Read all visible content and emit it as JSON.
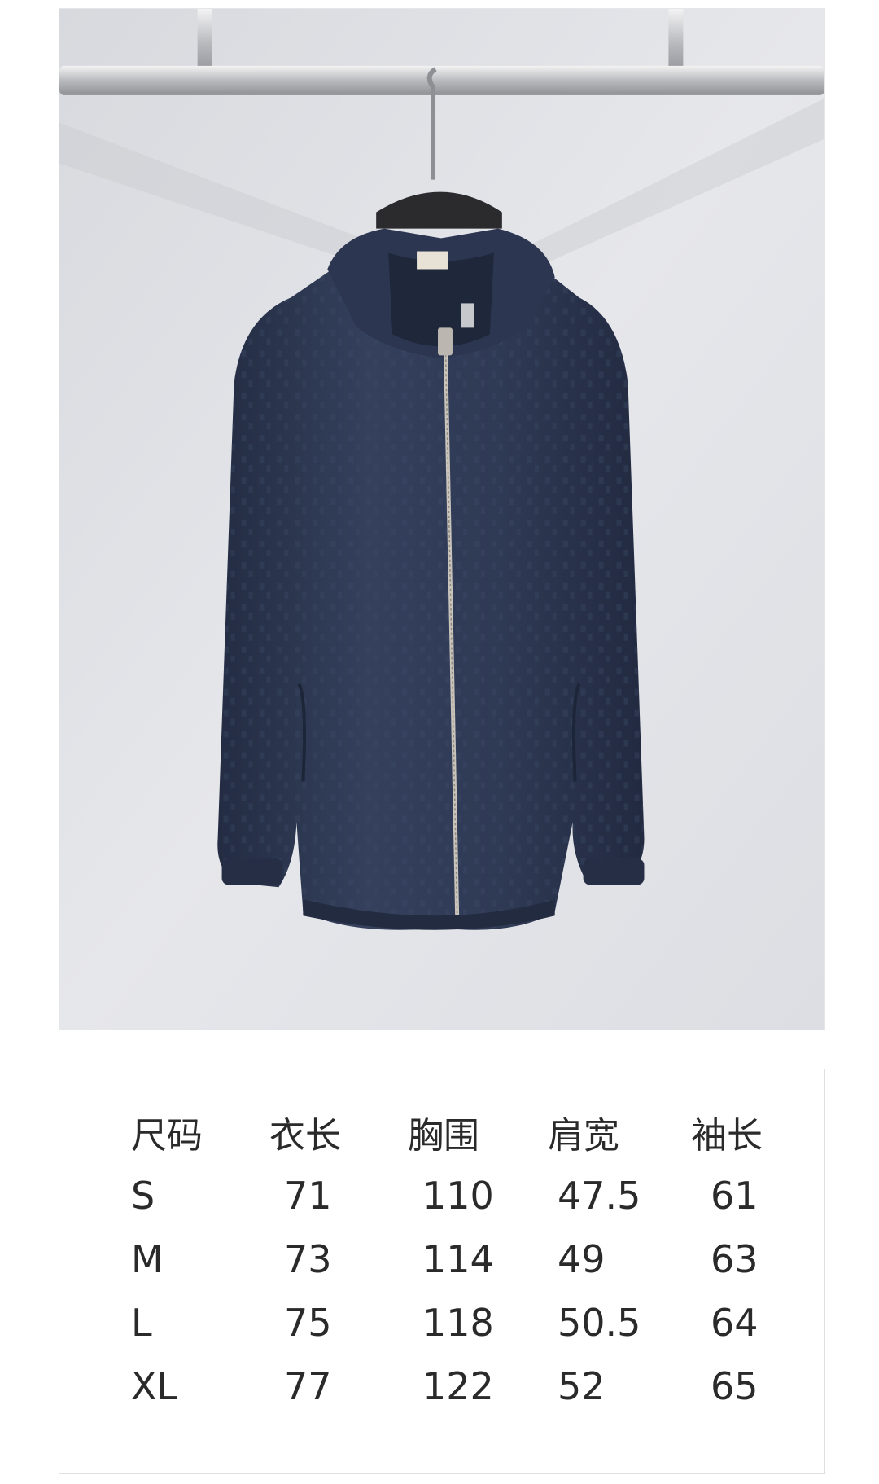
{
  "product_photo": {
    "description_icon": "jacket-photo",
    "colors": {
      "background": "#dfe1e6",
      "jacket": "#2d3852",
      "rail": "#c8c9cd"
    }
  },
  "size_chart": {
    "headers": [
      "尺码",
      "衣长",
      "胸围",
      "肩宽",
      "袖长"
    ],
    "rows": [
      [
        "S",
        "71",
        "110",
        "47.5",
        "61"
      ],
      [
        "M",
        "73",
        "114",
        "49",
        "63"
      ],
      [
        "L",
        "75",
        "118",
        "50.5",
        "64"
      ],
      [
        "XL",
        "77",
        "122",
        "52",
        "65"
      ]
    ]
  }
}
